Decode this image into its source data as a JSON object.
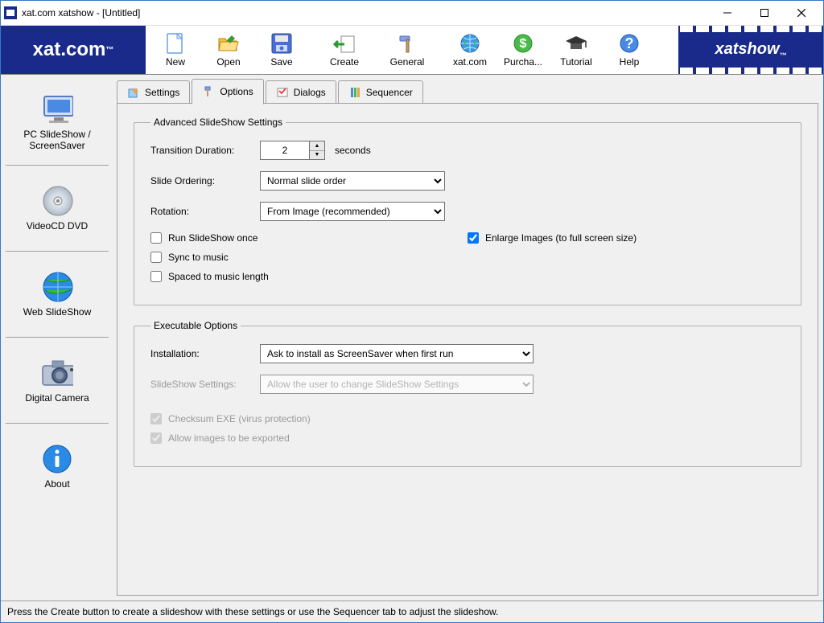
{
  "window": {
    "title": "xat.com xatshow - [Untitled]"
  },
  "logo": {
    "text": "xat.com",
    "product": "xatshow"
  },
  "toolbar": [
    {
      "id": "new",
      "label": "New"
    },
    {
      "id": "open",
      "label": "Open"
    },
    {
      "id": "save",
      "label": "Save"
    },
    {
      "id": "create",
      "label": "Create"
    },
    {
      "id": "general",
      "label": "General"
    },
    {
      "id": "xatcom",
      "label": "xat.com"
    },
    {
      "id": "purchase",
      "label": "Purcha..."
    },
    {
      "id": "tutorial",
      "label": "Tutorial"
    },
    {
      "id": "help",
      "label": "Help"
    }
  ],
  "sidebar": [
    {
      "id": "pc",
      "label": "PC SlideShow / ScreenSaver"
    },
    {
      "id": "dvd",
      "label": "VideoCD DVD"
    },
    {
      "id": "web",
      "label": "Web SlideShow"
    },
    {
      "id": "cam",
      "label": "Digital Camera"
    },
    {
      "id": "about",
      "label": "About"
    }
  ],
  "tabs": [
    {
      "id": "settings",
      "label": "Settings"
    },
    {
      "id": "options",
      "label": "Options"
    },
    {
      "id": "dialogs",
      "label": "Dialogs"
    },
    {
      "id": "sequencer",
      "label": "Sequencer"
    }
  ],
  "active_tab": "options",
  "advanced": {
    "legend": "Advanced SlideShow Settings",
    "transition_label": "Transition Duration:",
    "transition_value": "2",
    "transition_unit": "seconds",
    "ordering_label": "Slide Ordering:",
    "ordering_value": "Normal slide order",
    "rotation_label": "Rotation:",
    "rotation_value": "From Image (recommended)",
    "run_once_label": "Run SlideShow once",
    "run_once_checked": false,
    "sync_label": "Sync to music",
    "sync_checked": false,
    "spaced_label": "Spaced to music length",
    "spaced_checked": false,
    "enlarge_label": "Enlarge Images (to full screen size)",
    "enlarge_checked": true
  },
  "exe": {
    "legend": "Executable Options",
    "install_label": "Installation:",
    "install_value": "Ask to install as ScreenSaver when first run",
    "settings_label": "SlideShow Settings:",
    "settings_value": "Allow the user to change SlideShow Settings",
    "settings_enabled": false,
    "checksum_label": "Checksum EXE (virus protection)",
    "checksum_checked": true,
    "checksum_enabled": false,
    "export_label": "Allow images to be exported",
    "export_checked": true,
    "export_enabled": false
  },
  "status": "Press the Create button to create a slideshow with these settings or use the Sequencer tab to adjust the slideshow."
}
